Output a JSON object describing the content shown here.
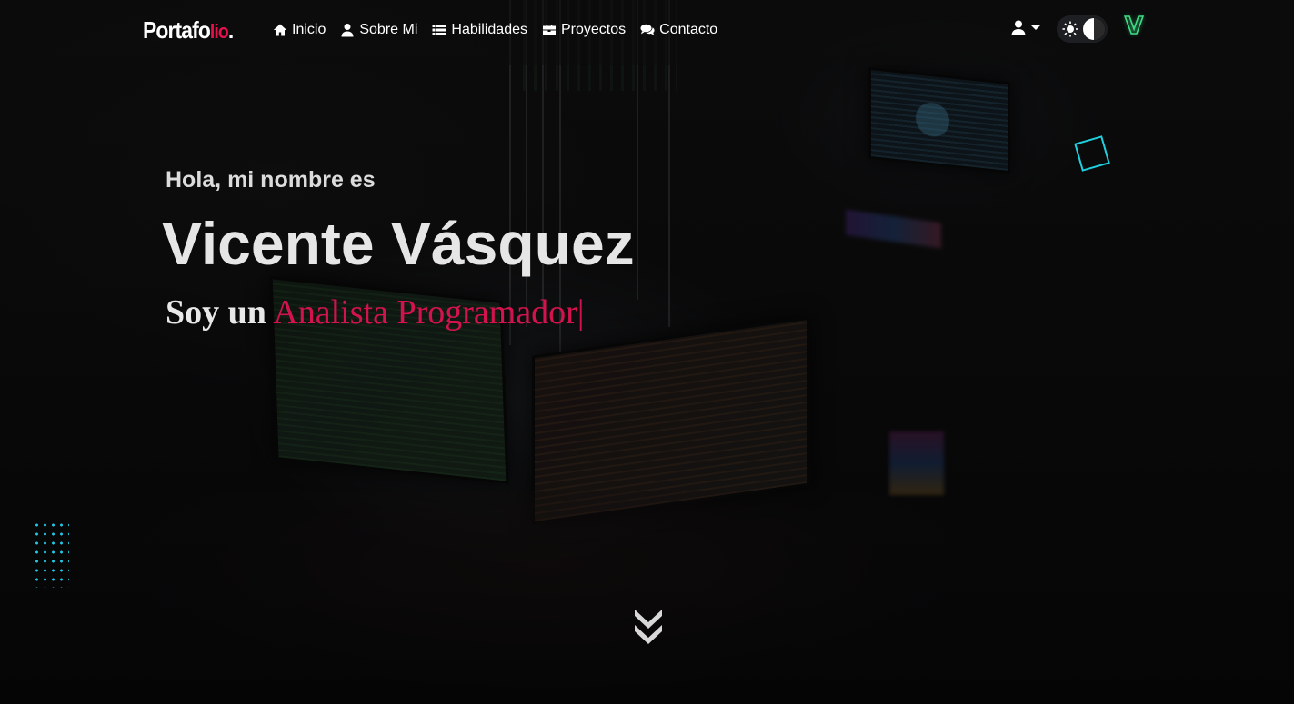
{
  "navbar": {
    "brand_main": "Portafo",
    "brand_accent": "lio",
    "brand_dot": ".",
    "links": [
      {
        "label": "Inicio",
        "icon": "home-icon"
      },
      {
        "label": "Sobre Mi",
        "icon": "user-icon"
      },
      {
        "label": "Habilidades",
        "icon": "list-icon"
      },
      {
        "label": "Proyectos",
        "icon": "briefcase-icon"
      },
      {
        "label": "Contacto",
        "icon": "comments-icon"
      }
    ],
    "user_menu_icon": "user-icon",
    "theme_toggle_icon": "sun-icon",
    "logo_letter": "V"
  },
  "hero": {
    "greeting": "Hola, mi nombre es",
    "name": "Vicente Vásquez",
    "role_prefix": "Soy un",
    "role_value": "Analista Programador",
    "typing_cursor": "|"
  },
  "scroll_indicator": {
    "icon": "double-chevron-down-icon"
  },
  "colors": {
    "accent": "#e8114e",
    "role_text": "#d4134e",
    "decor_cyan": "#1fd1e0",
    "logo_green": "#3ddc84",
    "text": "#e6e6e6"
  }
}
